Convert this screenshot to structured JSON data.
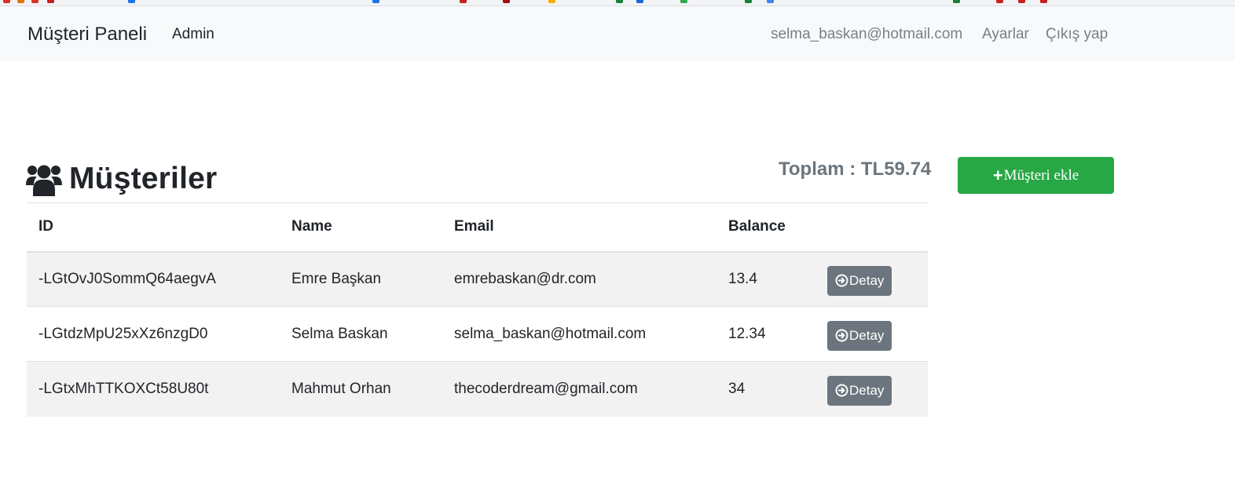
{
  "navbar": {
    "brand": "Müşteri Paneli",
    "admin": "Admin",
    "user_email": "selma_baskan@hotmail.com",
    "settings": "Ayarlar",
    "logout": "Çıkış yap"
  },
  "page": {
    "title": "Müşteriler",
    "title_icon": "users-icon",
    "total_label": "Toplam : ",
    "total_value": "TL59.74",
    "add_button_icon": "plus-icon",
    "add_button_label": "Müşteri ekle"
  },
  "table": {
    "headers": [
      "ID",
      "Name",
      "Email",
      "Balance"
    ],
    "detail_label": "Detay",
    "detail_icon": "arrow-circle-right-icon",
    "rows": [
      {
        "id": "-LGtOvJ0SommQ64aegvA",
        "name": "Emre Başkan",
        "email": "emrebaskan@dr.com",
        "balance": "13.4"
      },
      {
        "id": "-LGtdzMpU25xXz6nzgD0",
        "name": "Selma Baskan",
        "email": "selma_baskan@hotmail.com",
        "balance": "12.34"
      },
      {
        "id": "-LGtxMhTTKOXCt58U80t",
        "name": "Mahmut Orhan",
        "email": "thecoderdream@gmail.com",
        "balance": "34"
      }
    ]
  },
  "colors": {
    "navbar_bg": "#f8f9fa",
    "add_button": "#28a745",
    "detail_button": "#6c757d",
    "striped_row": "#f2f2f2",
    "total_text": "#6c757d"
  }
}
